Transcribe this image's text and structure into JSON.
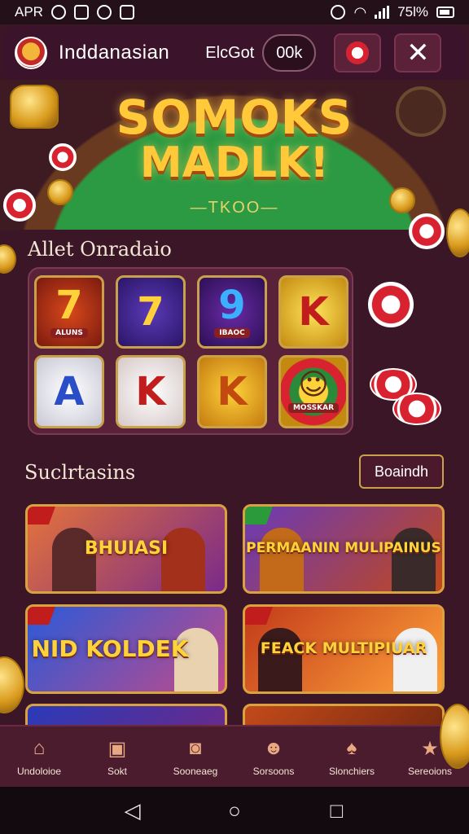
{
  "status_bar": {
    "left_text": "APR",
    "right_text": "75l%"
  },
  "header": {
    "title": "Inddanasian",
    "balance_label": "ElcGot",
    "balance_value": "00k"
  },
  "hero": {
    "title_line1": "SOMOKS",
    "title_line2": "MADLK!",
    "subtitle": "—TKOO—"
  },
  "slots_section": {
    "title": "Allet Onradaio",
    "tiles": [
      {
        "symbol": "7",
        "caption": "ALUNS"
      },
      {
        "symbol": "7",
        "caption": ""
      },
      {
        "symbol": "9",
        "caption": "IBAOC"
      },
      {
        "symbol": "K",
        "caption": ""
      },
      {
        "symbol": "A",
        "caption": ""
      },
      {
        "symbol": "K",
        "caption": ""
      },
      {
        "symbol": "K",
        "caption": ""
      },
      {
        "symbol": "☺",
        "caption": "MOSSKAR"
      }
    ]
  },
  "games_section": {
    "title": "Suclrtasins",
    "search_label": "Boaindh",
    "cards": [
      {
        "name": "BHUIASI"
      },
      {
        "name": "PERMAANIN MULIPAINUS"
      },
      {
        "name": "NID KOLDEK"
      },
      {
        "name": "FEACK MULTIPIUAR"
      },
      {
        "name": ""
      },
      {
        "name": ""
      }
    ]
  },
  "bottom_nav": {
    "items": [
      {
        "label": "Undoloioe",
        "icon": "home-icon"
      },
      {
        "label": "Sokt",
        "icon": "box-icon"
      },
      {
        "label": "Sooneaeg",
        "icon": "slot-machine-icon"
      },
      {
        "label": "Sorsoons",
        "icon": "mascot-icon"
      },
      {
        "label": "Slonchiers",
        "icon": "cards-icon"
      },
      {
        "label": "Sereoions",
        "icon": "star-badge-icon"
      }
    ]
  }
}
